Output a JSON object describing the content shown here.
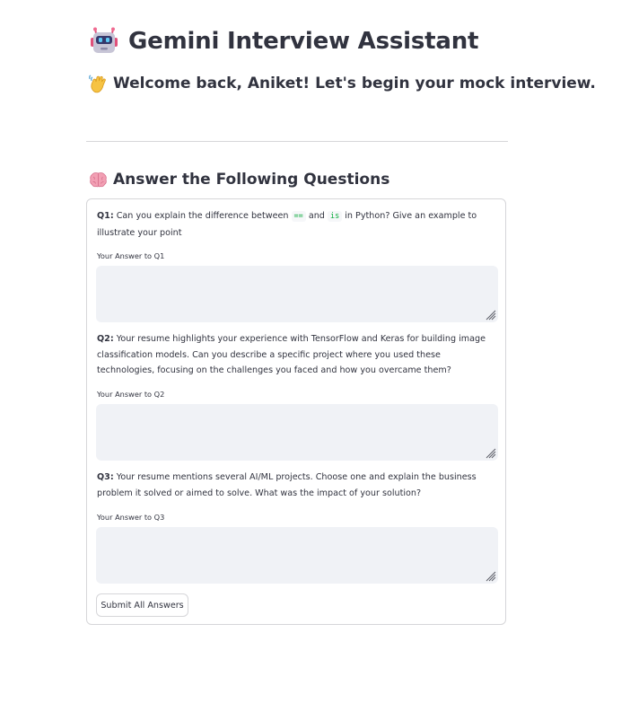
{
  "header": {
    "title": "Gemini Interview Assistant",
    "title_icon": "robot-icon",
    "welcome": "Welcome back, Aniket! Let's begin your mock interview.",
    "welcome_icon": "waving-hand-icon"
  },
  "section": {
    "title": "Answer the Following Questions",
    "icon": "brain-icon"
  },
  "questions": [
    {
      "prefix": "Q1:",
      "text_before_code1": "Can you explain the difference between",
      "code1": "==",
      "text_between": "and",
      "code2": "is",
      "text_after": "in Python? Give an example to illustrate your point",
      "answer_label": "Your Answer to Q1",
      "answer_value": ""
    },
    {
      "prefix": "Q2:",
      "text": "Your resume highlights your experience with TensorFlow and Keras for building image classification models. Can you describe a specific project where you used these technologies, focusing on the challenges you faced and how you overcame them?",
      "answer_label": "Your Answer to Q2",
      "answer_value": ""
    },
    {
      "prefix": "Q3:",
      "text": "Your resume mentions several AI/ML projects. Choose one and explain the business problem it solved or aimed to solve. What was the impact of your solution?",
      "answer_label": "Your Answer to Q3",
      "answer_value": ""
    }
  ],
  "submit_label": "Submit All Answers",
  "colors": {
    "text": "#31333f",
    "input_bg": "#f0f2f6",
    "border": "#d6d6d9",
    "code": "#09ab3b"
  }
}
